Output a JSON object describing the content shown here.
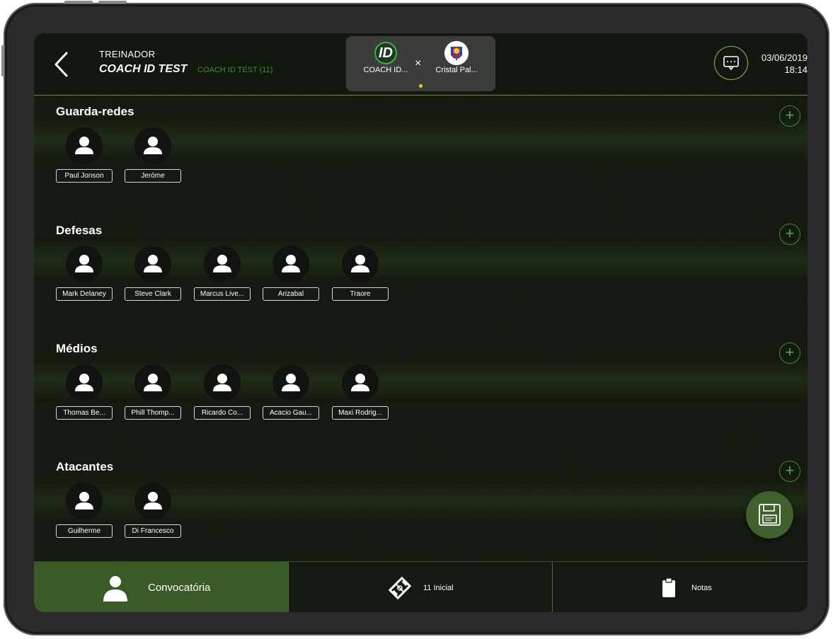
{
  "header": {
    "role": "TREINADOR",
    "team_name": "COACH ID TEST",
    "team_sub": "COACH ID TEST (11)",
    "match": {
      "home_logo_text": "ID",
      "home_label": "COACH ID...",
      "vs": "×",
      "away_label": "Cristal Pal..."
    },
    "date": "03/06/2019",
    "time": "18:14"
  },
  "sections": [
    {
      "title": "Guarda-redes",
      "players": [
        "Paul Jonson",
        "Jeróme"
      ]
    },
    {
      "title": "Defesas",
      "players": [
        "Mark Delaney",
        "Steve Clark",
        "Marcus Live...",
        "Arizabal",
        "Traore"
      ]
    },
    {
      "title": "Médios",
      "players": [
        "Thomas Be...",
        "Phill Thomp...",
        "Ricardo Co...",
        "Acacio Gau...",
        "Maxi Rodrig..."
      ]
    },
    {
      "title": "Atacantes",
      "players": [
        "Guilherme",
        "Di Francesco"
      ]
    }
  ],
  "add_symbol": "+",
  "tabs": [
    {
      "label": "Convocatória",
      "icon": "person-icon",
      "active": true
    },
    {
      "label": "11 Inicial",
      "icon": "field-icon",
      "active": false
    },
    {
      "label": "Notas",
      "icon": "clipboard-icon",
      "active": false
    }
  ],
  "colors": {
    "accent_green": "#3f8f2f",
    "active_tab": "#3a5a27",
    "header_bg": "#121710"
  }
}
